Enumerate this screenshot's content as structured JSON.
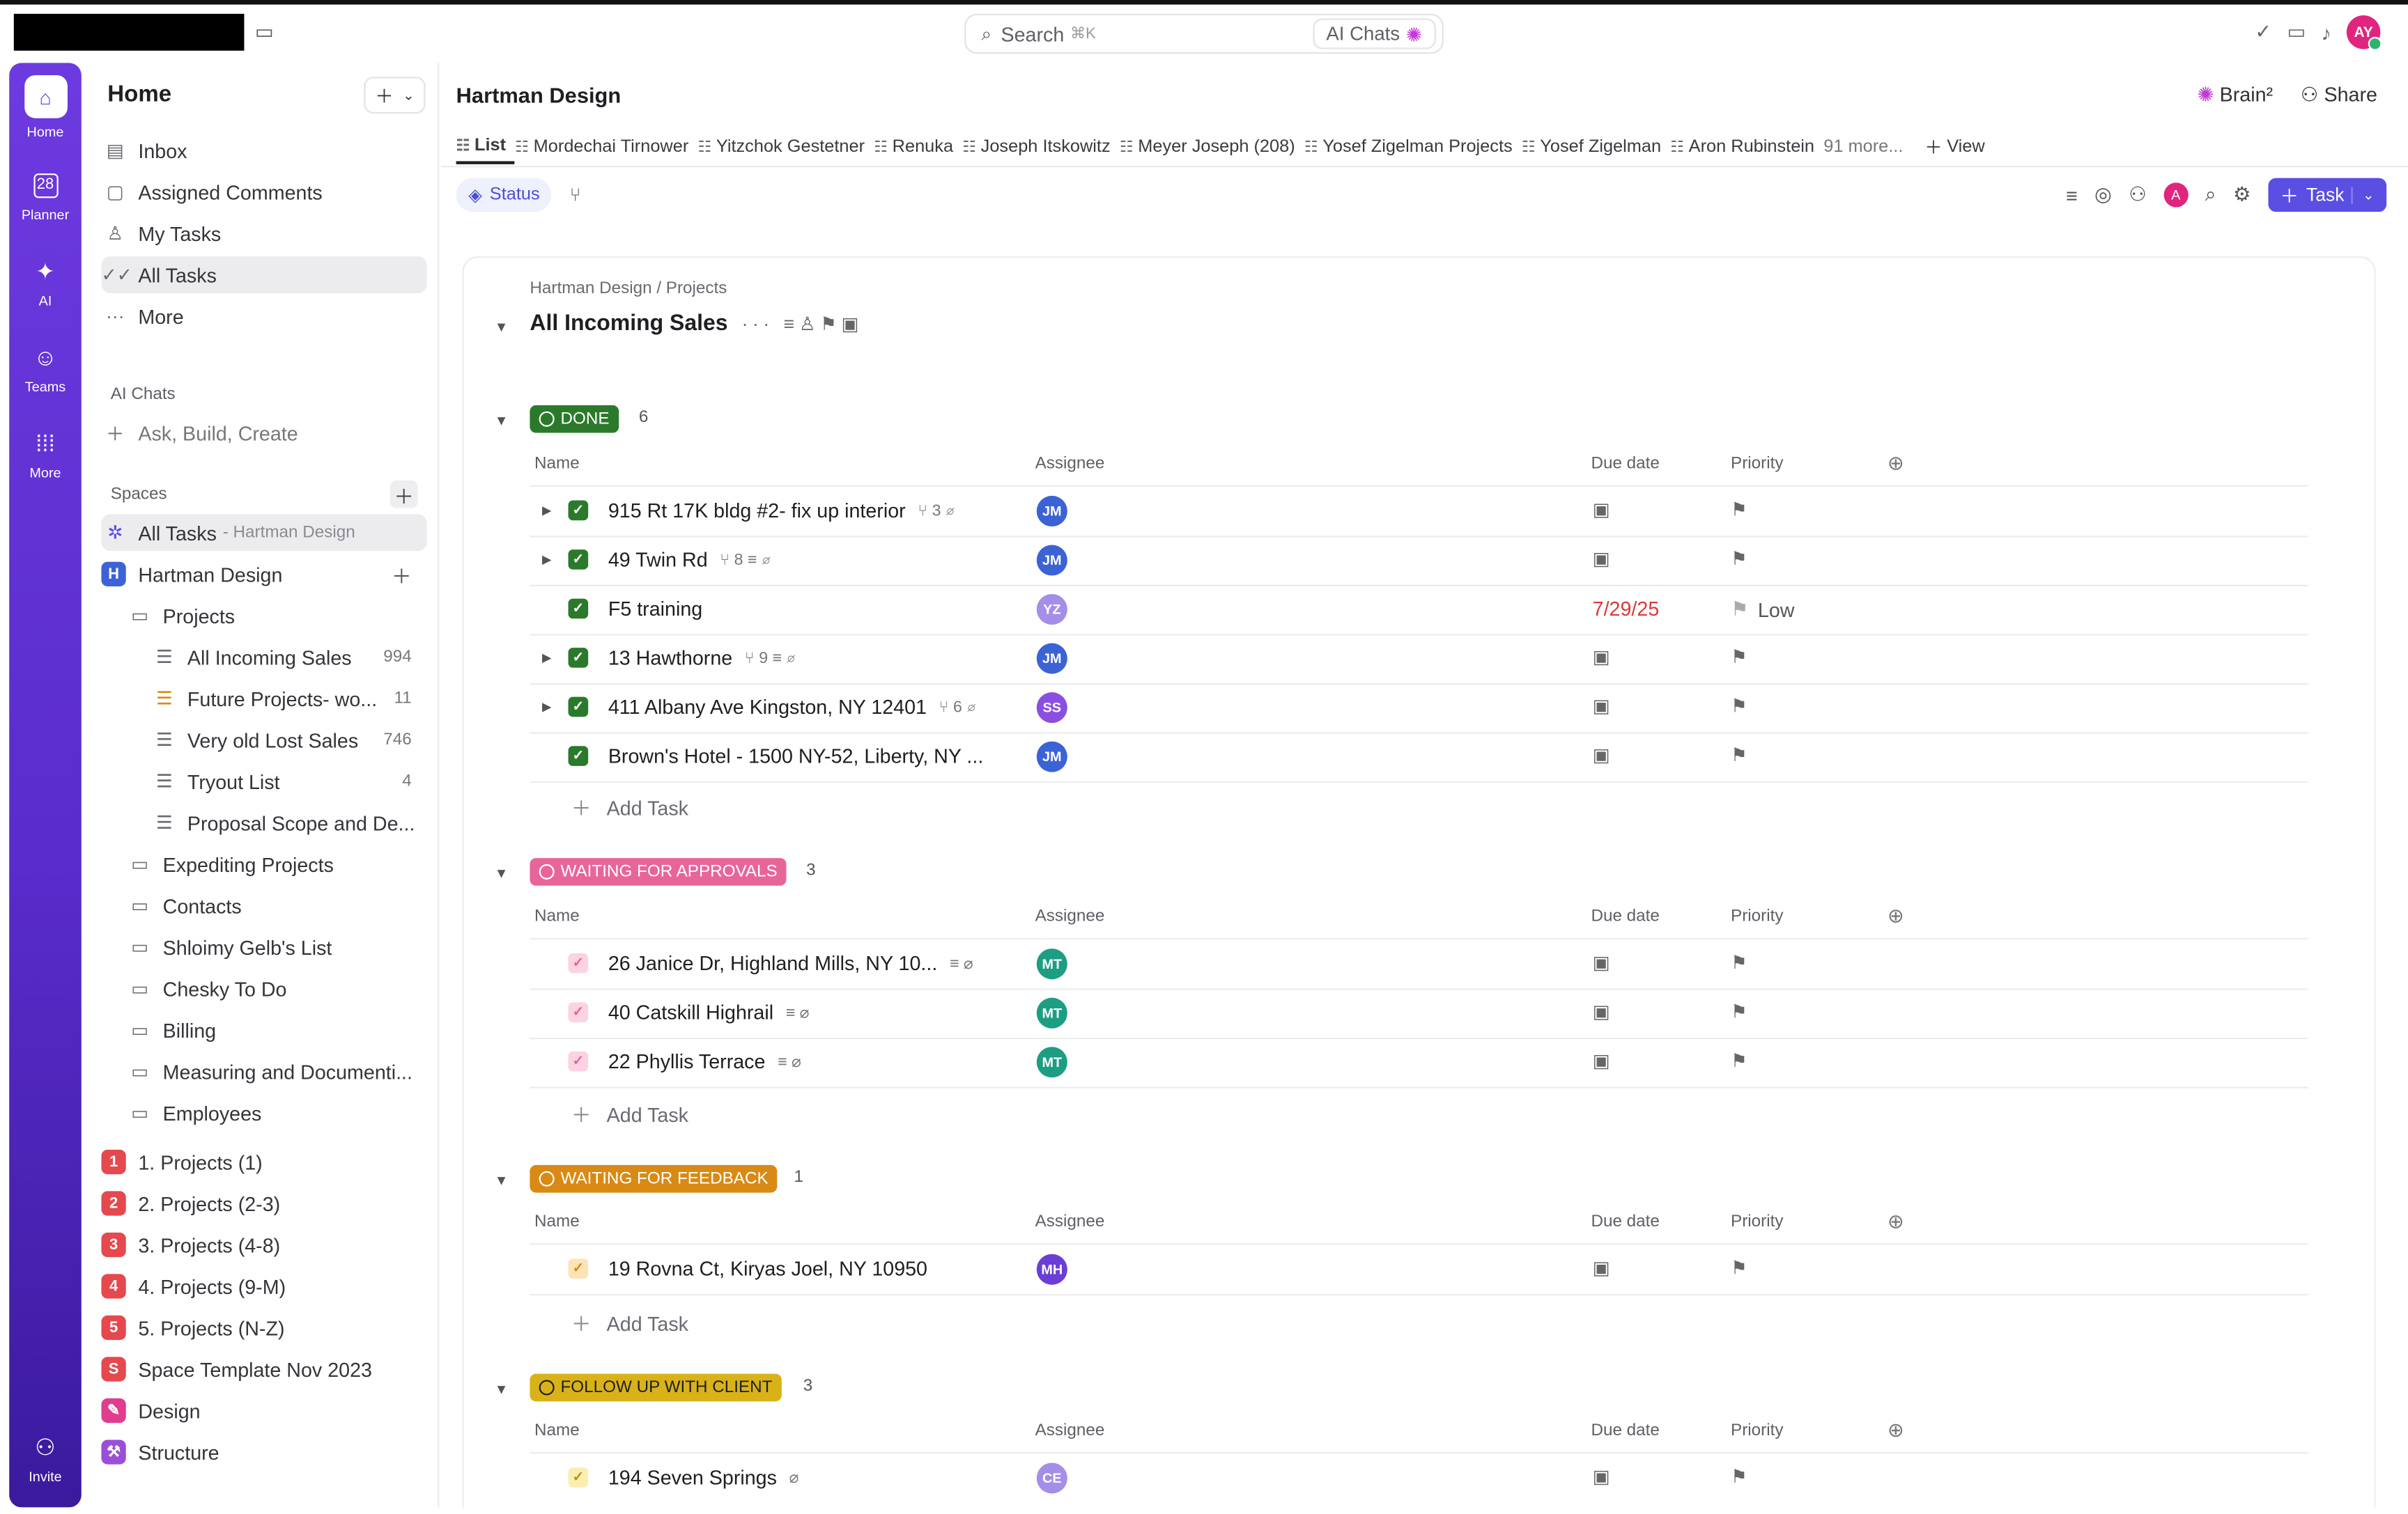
{
  "topbar": {
    "search_placeholder": "Search",
    "search_kbd": "⌘K",
    "ai_chats": "AI Chats",
    "user_initials": "AY"
  },
  "rail": {
    "home": "Home",
    "planner": "Planner",
    "planner_day": "28",
    "ai": "AI",
    "teams": "Teams",
    "more": "More",
    "invite": "Invite"
  },
  "sidebar": {
    "title": "Home",
    "nav": [
      {
        "label": "Inbox",
        "icon": "inbox-icon"
      },
      {
        "label": "Assigned Comments",
        "icon": "comment-icon"
      },
      {
        "label": "My Tasks",
        "icon": "user-icon"
      },
      {
        "label": "All Tasks",
        "icon": "double-check-icon"
      },
      {
        "label": "More",
        "icon": "dots-icon"
      }
    ],
    "ai_chats_title": "AI Chats",
    "ai_chats_item": "Ask, Build, Create",
    "spaces_title": "Spaces",
    "all_tasks": "All Tasks",
    "all_tasks_suffix": "- Hartman Design",
    "space_name": "Hartman Design",
    "space_letter": "H",
    "projects_folder": "Projects",
    "lists": [
      {
        "label": "All Incoming Sales",
        "count": "994"
      },
      {
        "label": "Future Projects- wo...",
        "count": "11"
      },
      {
        "label": "Very old Lost Sales",
        "count": "746"
      },
      {
        "label": "Tryout List",
        "count": "4"
      },
      {
        "label": "Proposal Scope and De...",
        "count": ""
      }
    ],
    "folders": [
      "Expediting Projects",
      "Contacts",
      "Shloimy Gelb's List",
      "Chesky To Do",
      "Billing",
      "Measuring and Documenti...",
      "Employees"
    ],
    "spaces": [
      {
        "letter": "1",
        "label": "1. Projects (1)",
        "color": "#e5484d"
      },
      {
        "letter": "2",
        "label": "2. Projects (2-3)",
        "color": "#e5484d"
      },
      {
        "letter": "3",
        "label": "3. Projects (4-8)",
        "color": "#e5484d"
      },
      {
        "letter": "4",
        "label": "4. Projects (9-M)",
        "color": "#e5484d"
      },
      {
        "letter": "5",
        "label": "5. Projects (N-Z)",
        "color": "#e5484d"
      },
      {
        "letter": "S",
        "label": "Space Template Nov 2023",
        "color": "#e5484d"
      },
      {
        "letter": "✎",
        "label": "Design",
        "color": "#e03d8f"
      },
      {
        "letter": "⚒",
        "label": "Structure",
        "color": "#9b4fd6"
      }
    ]
  },
  "header": {
    "title": "Hartman Design",
    "brain": "Brain²",
    "share": "Share",
    "tabs": [
      "List",
      "Mordechai Tirnower",
      "Yitzchok Gestetner",
      "Renuka",
      "Joseph Itskowitz",
      "Meyer Joseph (208)",
      "Yosef Zigelman Projects",
      "Yosef Zigelman",
      "Aron Rubinstein",
      "91 more...",
      "View"
    ],
    "status_chip": "Status",
    "task_button": "Task",
    "filter_avatar": "A"
  },
  "list": {
    "breadcrumb": "Hartman Design / Projects",
    "title": "All Incoming Sales",
    "columns": {
      "name": "Name",
      "assignee": "Assignee",
      "due": "Due date",
      "priority": "Priority"
    },
    "add_task": "Add Task",
    "groups": [
      {
        "label": "DONE",
        "count": "6",
        "color": "#2b7a2b",
        "rows": [
          {
            "name": "915 Rt 17K bldg #2- fix up interior",
            "meta": "⑂ 3  ⌀",
            "assignee": "JM",
            "avatar_color": "#3b63d6",
            "due": "",
            "priority": "",
            "expand": true
          },
          {
            "name": "49 Twin Rd",
            "meta": "⑂ 8  ≡  ⌀",
            "assignee": "JM",
            "avatar_color": "#3b63d6",
            "due": "",
            "priority": "",
            "expand": true
          },
          {
            "name": "F5 training",
            "meta": "",
            "assignee": "YZ",
            "avatar_color": "#a48ee8",
            "due": "7/29/25",
            "priority": "Low",
            "expand": false
          },
          {
            "name": "13 Hawthorne",
            "meta": "⑂ 9  ≡  ⌀",
            "assignee": "JM",
            "avatar_color": "#3b63d6",
            "due": "",
            "priority": "",
            "expand": true
          },
          {
            "name": "411 Albany Ave Kingston, NY 12401",
            "meta": "⑂ 6  ⌀",
            "assignee": "SS",
            "avatar_color": "#8b4fe0",
            "due": "",
            "priority": "",
            "expand": true
          },
          {
            "name": "Brown's Hotel - 1500 NY-52, Liberty, NY ...",
            "meta": "",
            "assignee": "JM",
            "avatar_color": "#3b63d6",
            "due": "",
            "priority": "",
            "expand": false
          }
        ]
      },
      {
        "label": "WAITING FOR APPROVALS",
        "count": "3",
        "color": "#e8659a",
        "rows": [
          {
            "name": "26 Janice Dr, Highland Mills, NY 10...",
            "meta": "≡  ⌀",
            "assignee": "MT",
            "avatar_color": "#1d9e83",
            "due": "",
            "priority": "",
            "expand": false
          },
          {
            "name": "40 Catskill Highrail",
            "meta": "≡  ⌀",
            "assignee": "MT",
            "avatar_color": "#1d9e83",
            "due": "",
            "priority": "",
            "expand": false
          },
          {
            "name": "22 Phyllis Terrace",
            "meta": "≡  ⌀",
            "assignee": "MT",
            "avatar_color": "#1d9e83",
            "due": "",
            "priority": "",
            "expand": false
          }
        ]
      },
      {
        "label": "WAITING FOR FEEDBACK",
        "count": "1",
        "color": "#d98a14",
        "rows": [
          {
            "name": "19 Rovna Ct, Kiryas Joel, NY 10950",
            "meta": "",
            "assignee": "MH",
            "avatar_color": "#6b3fd6",
            "due": "",
            "priority": "",
            "expand": false
          }
        ]
      },
      {
        "label": "FOLLOW UP WITH CLIENT",
        "count": "3",
        "color": "#d9b21a",
        "rows": [
          {
            "name": "194 Seven Springs",
            "meta": "⌀",
            "assignee": "CE",
            "avatar_color": "#a48ee8",
            "due": "",
            "priority": "",
            "expand": false
          }
        ]
      }
    ]
  }
}
